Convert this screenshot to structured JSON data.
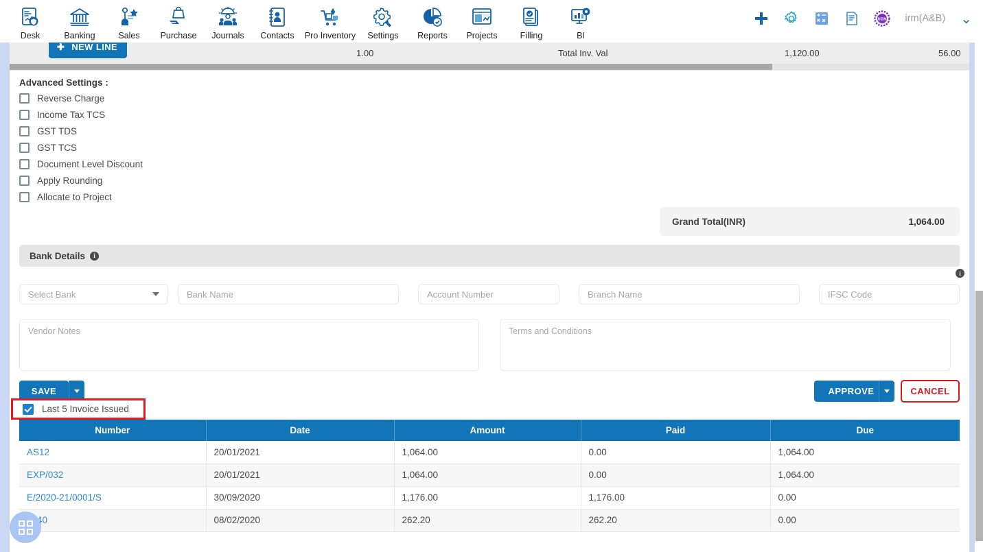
{
  "topnav": {
    "items": [
      {
        "label": "Desk",
        "icon": "desk-icon"
      },
      {
        "label": "Banking",
        "icon": "bank-icon"
      },
      {
        "label": "Sales",
        "icon": "sales-icon"
      },
      {
        "label": "Purchase",
        "icon": "purchase-icon"
      },
      {
        "label": "Journals",
        "icon": "journals-icon"
      },
      {
        "label": "Contacts",
        "icon": "contacts-icon"
      },
      {
        "label": "Pro Inventory",
        "icon": "inventory-icon"
      },
      {
        "label": "Settings",
        "icon": "settings-icon"
      },
      {
        "label": "Reports",
        "icon": "reports-icon"
      },
      {
        "label": "Projects",
        "icon": "projects-icon"
      },
      {
        "label": "Filling",
        "icon": "filling-icon"
      },
      {
        "label": "BI",
        "icon": "bi-icon"
      }
    ],
    "actions": [
      {
        "name": "add-icon",
        "label": "Add"
      },
      {
        "name": "gear-icon",
        "label": "Settings"
      },
      {
        "name": "calculator-icon",
        "label": "Calculator"
      },
      {
        "name": "notes-icon",
        "label": "Notes"
      },
      {
        "name": "new-badge-icon",
        "label": "NEW"
      }
    ],
    "firm": "irm(A&B)",
    "chevron": "⌄"
  },
  "line_items_clip": {
    "new_line_label": "NEW LINE",
    "new_line_plus": "✚",
    "qty": "1.00",
    "total_label": "Total Inv. Val",
    "total_value": "1,120.00",
    "tax_value": "56.00"
  },
  "advanced_settings": {
    "title": "Advanced Settings :",
    "options": [
      {
        "label": "Reverse Charge",
        "checked": false
      },
      {
        "label": "Income Tax TCS",
        "checked": false
      },
      {
        "label": "GST TDS",
        "checked": false
      },
      {
        "label": "GST TCS",
        "checked": false
      },
      {
        "label": "Document Level Discount",
        "checked": false
      },
      {
        "label": "Apply Rounding",
        "checked": false
      },
      {
        "label": "Allocate to Project",
        "checked": false
      }
    ]
  },
  "grand_total": {
    "label": "Grand Total(INR)",
    "value": "1,064.00"
  },
  "bank_details": {
    "section_title": "Bank Details",
    "info_glyph": "i",
    "select_bank": "Select Bank",
    "bank_name": "Bank Name",
    "account_number": "Account Number",
    "branch_name": "Branch Name",
    "ifsc_code": "IFSC Code"
  },
  "notes": {
    "vendor_notes_placeholder": "Vendor Notes",
    "vendor_notes_value": "",
    "terms_placeholder": "Terms and Conditions",
    "terms_value": "",
    "info_glyph": "i"
  },
  "actions": {
    "save": "SAVE",
    "approve": "APPROVE",
    "cancel": "CANCEL"
  },
  "last_invoices": {
    "toggle_label": "Last 5 Invoice Issued",
    "toggle_checked": true,
    "highlight_color": "#e8191e",
    "columns": [
      "Number",
      "Date",
      "Amount",
      "Paid",
      "Due"
    ],
    "rows": [
      {
        "number": "AS12",
        "date": "20/01/2021",
        "amount": "1,064.00",
        "paid": "0.00",
        "due": "1,064.00"
      },
      {
        "number": "EXP/032",
        "date": "20/01/2021",
        "amount": "1,064.00",
        "paid": "0.00",
        "due": "1,064.00"
      },
      {
        "number": "E/2020-21/0001/S",
        "date": "30/09/2020",
        "amount": "1,176.00",
        "paid": "1,176.00",
        "due": "0.00"
      },
      {
        "number": "7540",
        "date": "08/02/2020",
        "amount": "262.20",
        "paid": "262.20",
        "due": "0.00"
      }
    ]
  },
  "fab": {
    "name": "apps-grid-icon"
  },
  "colors": {
    "primary_blue": "#1275b8",
    "link_blue": "#2e8bd0",
    "danger_red": "#d51a22",
    "highlight_red": "#e8191e",
    "panel_gray": "#e6e6e6"
  }
}
